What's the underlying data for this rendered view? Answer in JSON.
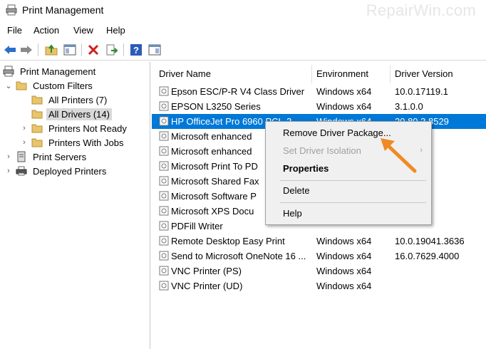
{
  "window": {
    "title": "Print Management",
    "watermark": "RepairWin.com"
  },
  "menu": [
    "File",
    "Action",
    "View",
    "Help"
  ],
  "toolbar": {
    "buttons": [
      "back-icon",
      "forward-icon",
      "up-folder-icon",
      "show-hide-tree-icon",
      "delete-icon",
      "export-icon",
      "help-icon",
      "action-pane-icon"
    ]
  },
  "tree": {
    "root": "Print Management",
    "custom_filters": "Custom Filters",
    "all_printers": "All Printers (7)",
    "all_drivers": "All Drivers (14)",
    "printers_not_ready": "Printers Not Ready",
    "printers_with_jobs": "Printers With Jobs",
    "print_servers": "Print Servers",
    "deployed_printers": "Deployed Printers"
  },
  "list": {
    "columns": [
      "Driver Name",
      "Environment",
      "Driver Version"
    ],
    "rows": [
      [
        "Epson ESC/P-R V4 Class Driver",
        "Windows x64",
        "10.0.17119.1"
      ],
      [
        "EPSON L3250 Series",
        "Windows x64",
        "3.1.0.0"
      ],
      [
        "HP OfficeJet Pro 6960 PCL-3",
        "Windows x64",
        "20.80.3.8529"
      ],
      [
        "Microsoft enhanced",
        "",
        ".1.5247"
      ],
      [
        "Microsoft enhanced",
        "",
        ".1.5247"
      ],
      [
        "Microsoft Print To PD",
        "",
        ".1"
      ],
      [
        "Microsoft Shared Fax",
        "",
        ".1.5072"
      ],
      [
        "Microsoft Software P",
        "",
        ".1"
      ],
      [
        "Microsoft XPS Docu",
        "",
        ".1"
      ],
      [
        "PDFill Writer",
        "",
        ""
      ],
      [
        "Remote Desktop Easy Print",
        "Windows x64",
        "10.0.19041.3636"
      ],
      [
        "Send to Microsoft OneNote 16 ...",
        "Windows x64",
        "16.0.7629.4000"
      ],
      [
        "VNC Printer (PS)",
        "Windows x64",
        ""
      ],
      [
        "VNC Printer (UD)",
        "Windows x64",
        ""
      ]
    ]
  },
  "context_menu": {
    "remove": "Remove Driver Package...",
    "isolation": "Set Driver Isolation",
    "properties": "Properties",
    "delete": "Delete",
    "help": "Help"
  },
  "colors": {
    "selection": "#0078d7",
    "arrow": "#f08a24"
  }
}
